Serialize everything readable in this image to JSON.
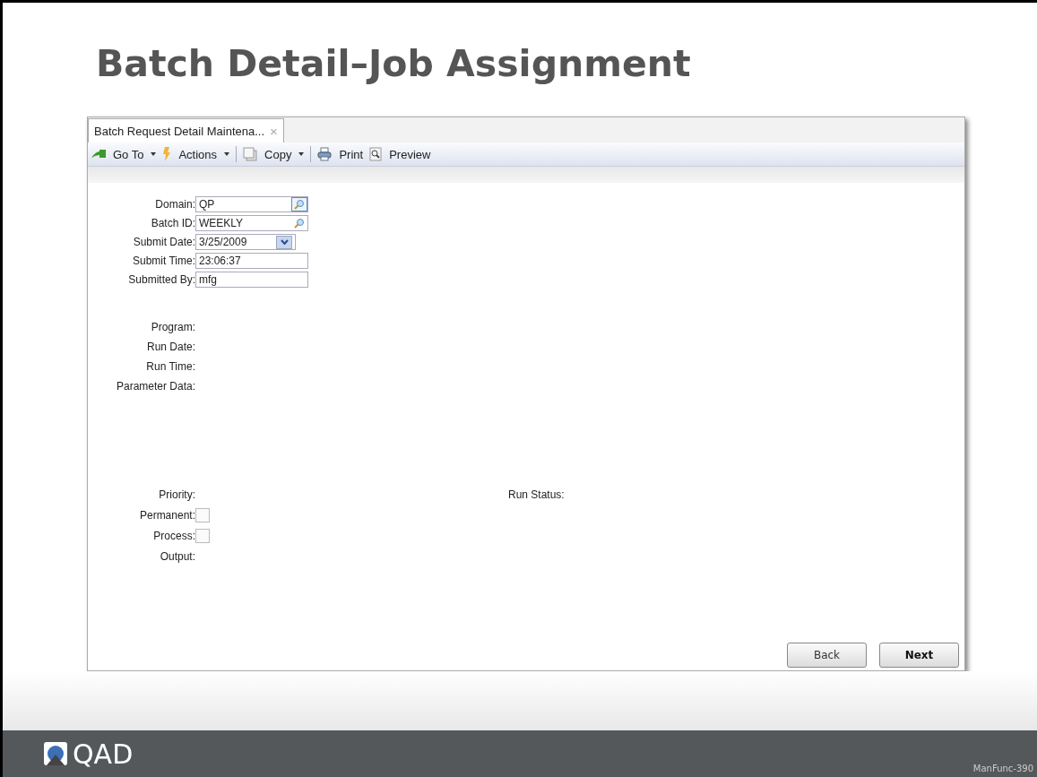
{
  "slide_title": "Batch Detail–Job Assignment",
  "window": {
    "tab": {
      "label": "Batch Request Detail Maintena...",
      "close": "×"
    },
    "toolbar": [
      {
        "label": "Go To",
        "dropdown": true
      },
      {
        "label": "Actions",
        "dropdown": true
      },
      {
        "label": "Copy",
        "dropdown": true
      },
      {
        "label": "Print",
        "dropdown": false
      },
      {
        "label": "Preview",
        "dropdown": false
      }
    ],
    "fields": [
      {
        "label": "Domain:",
        "value": "QP",
        "kind": "lookup",
        "focused": true
      },
      {
        "label": "Batch ID:",
        "value": "WEEKLY",
        "kind": "lookup",
        "focused": false
      },
      {
        "label": "Submit Date:",
        "value": "3/25/2009",
        "kind": "date",
        "focused": false
      },
      {
        "label": "Submit Time:",
        "value": "23:06:37",
        "kind": "text",
        "focused": false
      },
      {
        "label": "Submitted By:",
        "value": "mfg",
        "kind": "text",
        "focused": false
      }
    ],
    "details": [
      "Program:",
      "Run Date:",
      "Run Time:",
      "Parameter Data:"
    ],
    "options": [
      {
        "label": "Priority:",
        "kind": "label"
      },
      {
        "label": "Permanent:",
        "kind": "checkbox",
        "checked": false
      },
      {
        "label": "Process:",
        "kind": "checkbox",
        "checked": false
      },
      {
        "label": "Output:",
        "kind": "label"
      }
    ],
    "run_status": "Run Status:",
    "buttons": [
      {
        "label": "Back",
        "primary": false
      },
      {
        "label": "Next",
        "primary": true
      }
    ]
  },
  "footer": {
    "logo": "QAD",
    "slide_id": "ManFunc-390"
  }
}
